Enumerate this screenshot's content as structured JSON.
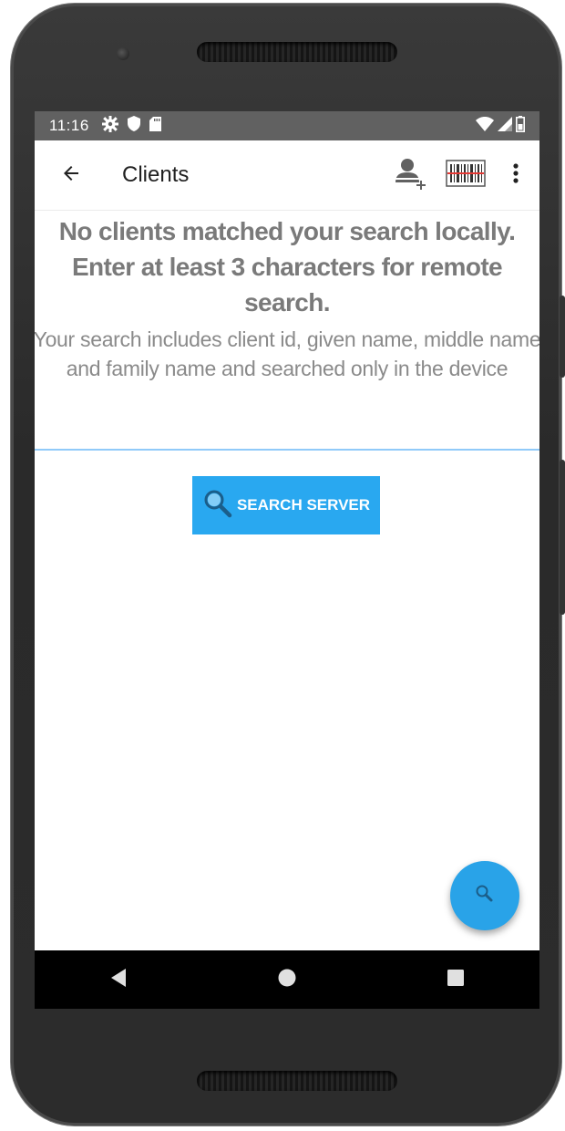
{
  "status_bar": {
    "time": "11:16",
    "icons": [
      "settings-icon",
      "shield-icon",
      "sd-card-icon",
      "wifi-icon",
      "signal-icon",
      "battery-icon"
    ]
  },
  "app_bar": {
    "title": "Clients",
    "actions": [
      "add-client-icon",
      "barcode-icon",
      "more-vert-icon"
    ]
  },
  "empty_state": {
    "heading": "No clients matched your search locally. Enter at least 3 characters for remote search.",
    "description": "Your search includes client id, given name, middle name and family name and searched only in the device"
  },
  "search_button": {
    "label": "SEARCH SERVER",
    "icon": "search-icon"
  },
  "fab": {
    "icon": "search-icon"
  },
  "colors": {
    "status_bar": "#616161",
    "accent": "#29a8f0",
    "divider": "#90caf9",
    "heading_text": "#7a7a7a"
  },
  "nav_bar": {
    "buttons": [
      "back-triangle-icon",
      "home-circle-icon",
      "recents-square-icon"
    ]
  }
}
